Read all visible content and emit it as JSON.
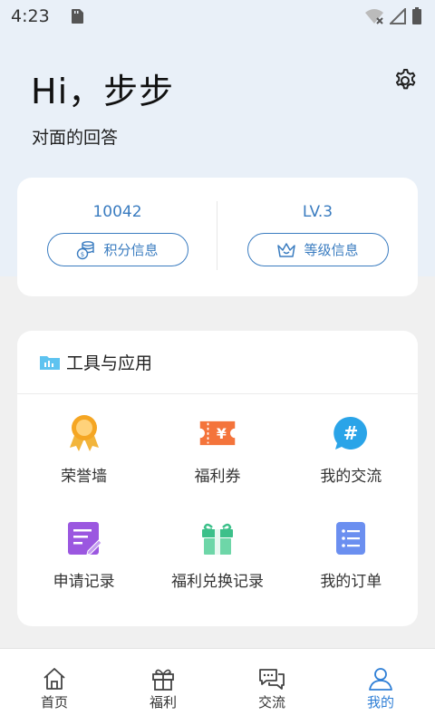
{
  "status_bar": {
    "time": "4:23"
  },
  "header": {
    "greeting": "Hi，步步",
    "subtitle": "对面的回答"
  },
  "stats": {
    "points": {
      "value": "10042",
      "button_label": "积分信息"
    },
    "level": {
      "value": "LV.3",
      "button_label": "等级信息"
    }
  },
  "tools": {
    "title": "工具与应用",
    "items": [
      {
        "label": "荣誉墙",
        "icon": "medal-icon"
      },
      {
        "label": "福利券",
        "icon": "coupon-icon"
      },
      {
        "label": "我的交流",
        "icon": "hashtag-chat-icon"
      },
      {
        "label": "申请记录",
        "icon": "notepad-pencil-icon"
      },
      {
        "label": "福利兑换记录",
        "icon": "gift-icon"
      },
      {
        "label": "我的订单",
        "icon": "list-icon"
      }
    ]
  },
  "bottom_nav": {
    "items": [
      {
        "label": "首页",
        "icon": "home-icon"
      },
      {
        "label": "福利",
        "icon": "gift-outline-icon"
      },
      {
        "label": "交流",
        "icon": "chat-icon"
      },
      {
        "label": "我的",
        "icon": "user-icon"
      }
    ],
    "active_index": 3
  },
  "colors": {
    "accent": "#3a7cc0",
    "nav_active": "#2f7fd6",
    "header_bg": "#e9f0f8",
    "page_bg": "#f0f0f0"
  }
}
